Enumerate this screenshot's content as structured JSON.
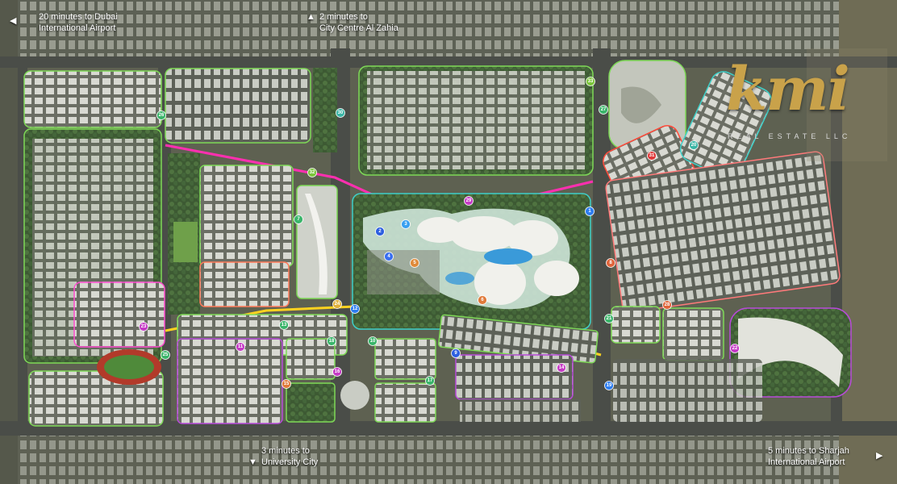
{
  "brand": {
    "logo_text": "kmi",
    "subtitle": "REAL ESTATE LLC",
    "logo_color": "#c9a24a"
  },
  "callouts": {
    "dubai_airport": {
      "line1": "20 minutes to Dubai",
      "line2": "International Airport",
      "arrow": "left-arrow-icon"
    },
    "city_centre": {
      "line1": "2 minutes to",
      "line2": "City Centre Al Zahia",
      "arrow": "up-arrow-icon"
    },
    "university_city": {
      "line1": "3 minutes to",
      "line2": "University City",
      "arrow": "down-arrow-icon"
    },
    "sharjah_airport": {
      "line1": "5 minutes to Sharjah",
      "line2": "International Airport",
      "arrow": "right-arrow-icon"
    }
  },
  "markers": [
    {
      "label": "1",
      "color": "#2d7df0"
    },
    {
      "label": "2",
      "color": "#2d5fe0"
    },
    {
      "label": "3",
      "color": "#3aa0f0"
    },
    {
      "label": "4",
      "color": "#3a6ff0"
    },
    {
      "label": "5",
      "color": "#e08a3a"
    },
    {
      "label": "6",
      "color": "#e07a3a"
    },
    {
      "label": "7",
      "color": "#3ab56a"
    },
    {
      "label": "8",
      "color": "#e0643a"
    },
    {
      "label": "9",
      "color": "#2d5fe0"
    },
    {
      "label": "10",
      "color": "#3ab56a"
    },
    {
      "label": "11",
      "color": "#c53ac5"
    },
    {
      "label": "12",
      "color": "#2d7df0"
    },
    {
      "label": "13",
      "color": "#3ab56a"
    },
    {
      "label": "14",
      "color": "#c53ac5"
    },
    {
      "label": "15",
      "color": "#e07a3a"
    },
    {
      "label": "16",
      "color": "#c53ac5"
    },
    {
      "label": "17",
      "color": "#3ab56a"
    },
    {
      "label": "18",
      "color": "#3ab56a"
    },
    {
      "label": "19",
      "color": "#2d7df0"
    },
    {
      "label": "20",
      "color": "#3ab5a5"
    },
    {
      "label": "21",
      "color": "#3ab56a"
    },
    {
      "label": "22",
      "color": "#c53ac5"
    },
    {
      "label": "23",
      "color": "#c53ac5"
    },
    {
      "label": "24",
      "color": "#e0b03a"
    },
    {
      "label": "25",
      "color": "#3ab56a"
    },
    {
      "label": "26",
      "color": "#3ab56a"
    },
    {
      "label": "27",
      "color": "#3ab56a"
    },
    {
      "label": "28",
      "color": "#e0643a"
    },
    {
      "label": "29",
      "color": "#c53ac5"
    },
    {
      "label": "30",
      "color": "#3ab5a5"
    },
    {
      "label": "31",
      "color": "#e03a3a"
    },
    {
      "label": "32",
      "color": "#7ac53a"
    },
    {
      "label": "33",
      "color": "#7ac53a"
    }
  ],
  "colors": {
    "road": "#4a4d48",
    "ground": "#5e6151",
    "green_outline": "#7ed957",
    "pink_road": "#ff2fb0",
    "yellow_road": "#ffd21f",
    "purple_outline": "#b84ad9",
    "red_outline": "#ff4a3a",
    "teal_outline": "#3fd0c9"
  }
}
